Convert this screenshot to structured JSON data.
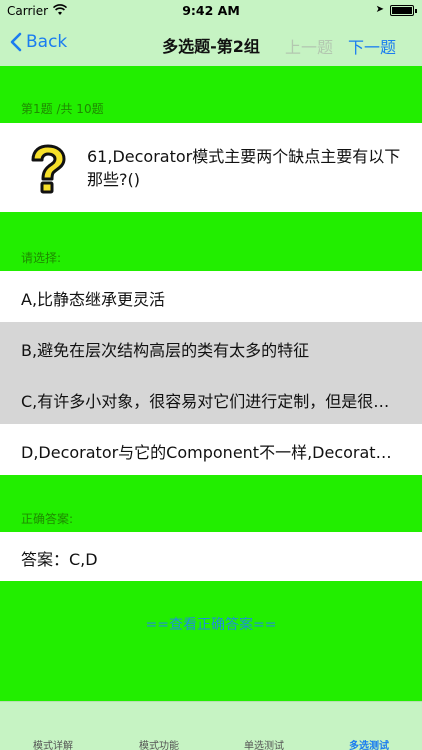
{
  "status": {
    "carrier": "Carrier",
    "time": "9:42 AM"
  },
  "nav": {
    "back_label": "Back",
    "title": "多选题-第2组",
    "prev_label": "上一题",
    "next_label": "下一题"
  },
  "question": {
    "progress": "第1题 /共 10题",
    "text": "61,Decorator模式主要两个缺点主要有以下那些?()"
  },
  "options_label": "请选择:",
  "options": [
    {
      "text": "A,比静态继承更灵活",
      "selected": false
    },
    {
      "text": "B,避免在层次结构高层的类有太多的特征",
      "selected": true
    },
    {
      "text": "C,有许多小对象，很容易对它们进行定制，但是很难学习这些系统",
      "selected": true
    },
    {
      "text": "D,Decorator与它的Component不一样,Decorator是一个透明的包装",
      "selected": false
    }
  ],
  "answer_label": "正确答案:",
  "answer_text": "答案：C,D",
  "show_answer_label": "==查看正确答案==",
  "tabs": [
    {
      "label": "模式详解",
      "active": false
    },
    {
      "label": "模式功能",
      "active": false
    },
    {
      "label": "单选测试",
      "active": false
    },
    {
      "label": "多选测试",
      "active": true
    }
  ],
  "colors": {
    "accent": "#1a7cf0",
    "background": "#22ee00",
    "bar": "#c6f3c3"
  }
}
